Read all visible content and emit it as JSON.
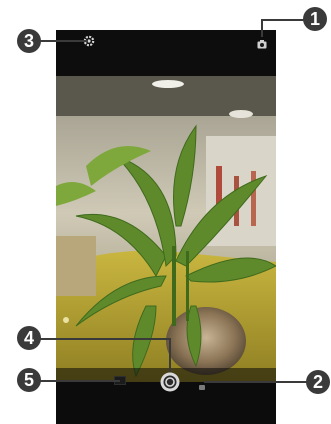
{
  "callouts": {
    "c1": "1",
    "c2": "2",
    "c3": "3",
    "c4": "4",
    "c5": "5"
  },
  "icons": {
    "settings": "gear-icon",
    "mode": "camera-mode-icon",
    "shutter": "shutter-icon",
    "gallery": "gallery-thumbnail-icon",
    "switch": "switch-camera-icon"
  },
  "colors": {
    "callout": "#3a3a3a",
    "bars": "#0c0c0c"
  }
}
